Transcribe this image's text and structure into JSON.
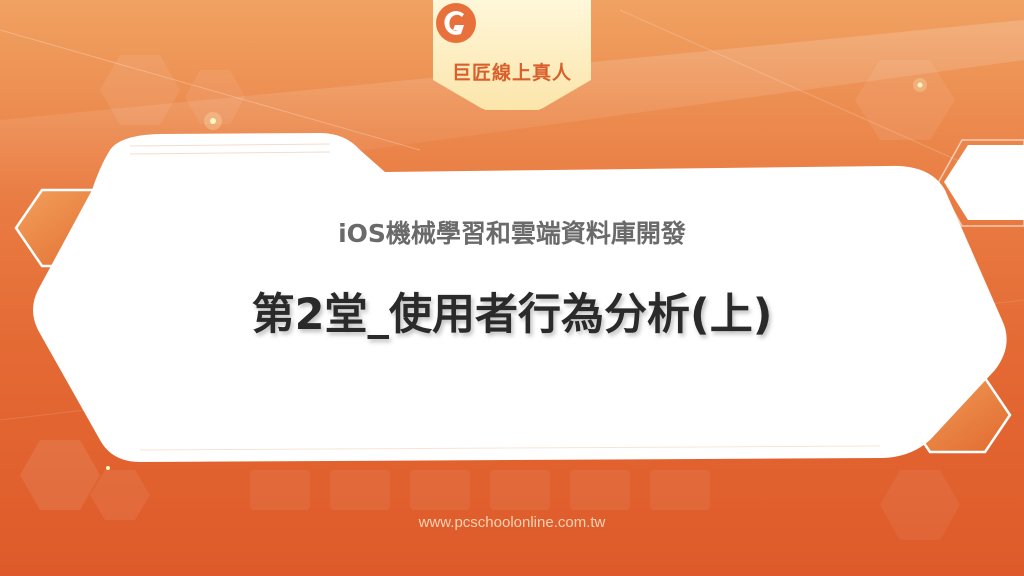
{
  "brand": {
    "name": "巨匠線上真人",
    "logo_icon": "g-logo-icon",
    "accent_color": "#e8703a"
  },
  "slide": {
    "subtitle": "iOS機械學習和雲端資料庫開發",
    "title": "第2堂_使用者行為分析(上)"
  },
  "footer": {
    "website": "www.pcschoolonline.com.tw"
  }
}
